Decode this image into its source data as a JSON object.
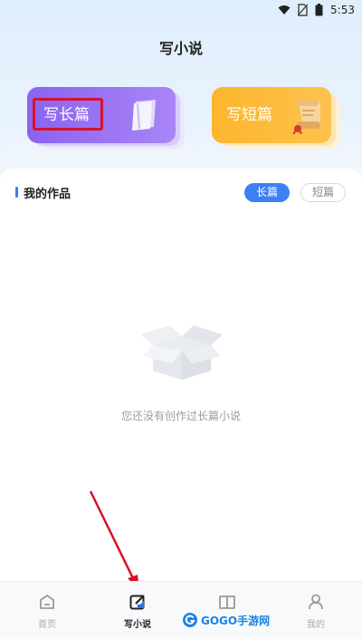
{
  "status_bar": {
    "time": "5:53"
  },
  "page_title": "写小说",
  "cards": {
    "long_label": "写长篇",
    "short_label": "写短篇"
  },
  "works": {
    "title": "我的作品",
    "tabs": [
      "长篇",
      "短篇"
    ],
    "active_tab": "长篇",
    "empty_text": "您还没有创作过长篇小说"
  },
  "bottom_nav": {
    "items": [
      {
        "label": "首页",
        "icon": "home-icon",
        "active": false
      },
      {
        "label": "写小说",
        "icon": "edit-icon",
        "active": true
      },
      {
        "label": "",
        "icon": "book-icon",
        "active": false
      },
      {
        "label": "我的",
        "icon": "person-icon",
        "active": false
      }
    ]
  },
  "watermark": {
    "text": "GOGO手游网"
  },
  "colors": {
    "accent_blue": "#3d7ff5",
    "long_card_purple": "#8a63f0",
    "short_card_orange": "#fdb52d",
    "annotation_red": "#d4122b"
  }
}
